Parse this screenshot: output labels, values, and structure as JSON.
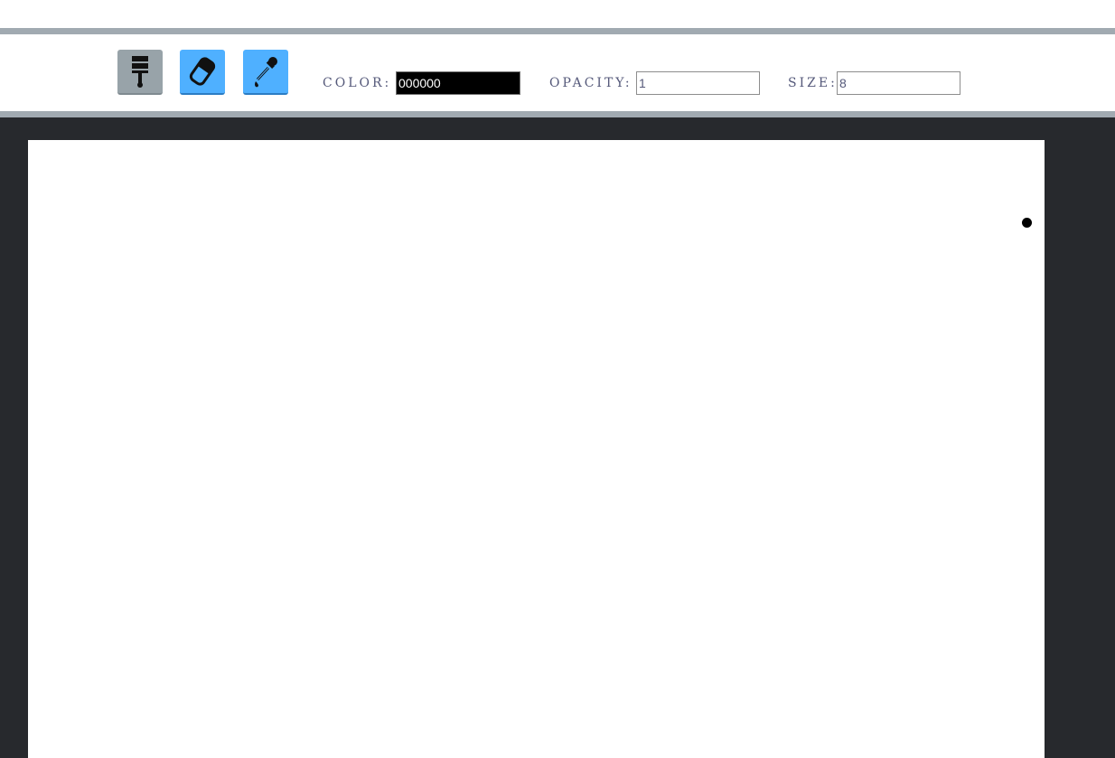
{
  "toolbar": {
    "tools": [
      {
        "name": "brush",
        "icon": "paintbrush-icon",
        "active": true
      },
      {
        "name": "eraser",
        "icon": "eraser-icon",
        "active": false
      },
      {
        "name": "picker",
        "icon": "eyedropper-icon",
        "active": false
      }
    ],
    "color_label": "COLOR:",
    "color_value": "000000",
    "opacity_label": "OPACITY:",
    "opacity_value": "1",
    "size_label": "SIZE:",
    "size_value": "8"
  },
  "colors": {
    "rule": "#a1aab1",
    "active_tool": "#98a3a9",
    "tool_blue": "#4fb0ff",
    "workspace": "#27292d",
    "label_text": "#55597a",
    "canvas": "#ffffff"
  }
}
